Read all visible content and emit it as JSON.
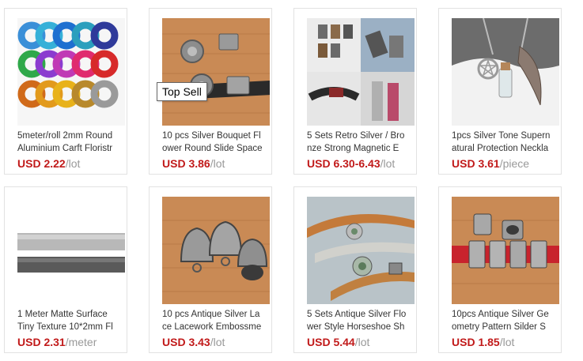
{
  "tooltip": "Top Sell",
  "products": [
    {
      "title1": "5meter/roll 2mm Round",
      "title2": "Aluminium Carft Floristr",
      "price": "USD 2.22",
      "unit": "/lot"
    },
    {
      "title1": "10 pcs Silver Bouquet Fl",
      "title2": "ower Round Slide Space",
      "price": "USD 3.86",
      "unit": "/lot"
    },
    {
      "title1": "5 Sets Retro Silver / Bro",
      "title2": "nze Strong Magnetic E",
      "price": "USD 6.30-6.43",
      "unit": "/lot"
    },
    {
      "title1": "1pcs Silver Tone Supern",
      "title2": "atural Protection Neckla",
      "price": "USD 3.61",
      "unit": "/piece"
    },
    {
      "title1": "1 Meter Matte Surface",
      "title2": "Tiny Texture 10*2mm Fl",
      "price": "USD 2.31",
      "unit": "/meter"
    },
    {
      "title1": "10 pcs Antique Silver La",
      "title2": "ce Lacework Embossme",
      "price": "USD 3.43",
      "unit": "/lot"
    },
    {
      "title1": "5 Sets Antique Silver Flo",
      "title2": "wer Style Horseshoe Sh",
      "price": "USD 5.44",
      "unit": "/lot"
    },
    {
      "title1": "10pcs Antique Silver Ge",
      "title2": "ometry Pattern Silder S",
      "price": "USD 1.85",
      "unit": "/lot"
    }
  ]
}
